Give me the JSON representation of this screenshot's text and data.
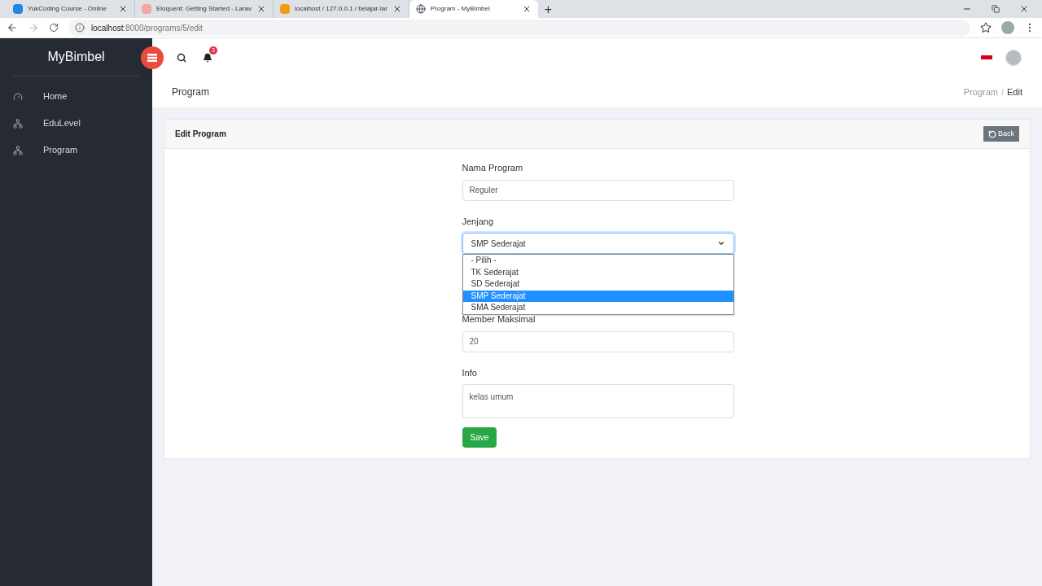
{
  "browser": {
    "tabs": [
      {
        "title": "YukCoding Course - Online",
        "selected": false
      },
      {
        "title": "Eloquent: Getting Started - Larav",
        "selected": false
      },
      {
        "title": "localhost / 127.0.0.1 / belajar-lar",
        "selected": false
      },
      {
        "title": "Program - MyBimbel",
        "selected": true
      }
    ],
    "new_tab": "+",
    "url_host": "localhost",
    "url_rest": ":8000/programs/5/edit"
  },
  "sidebar": {
    "brand": "MyBimbel",
    "items": [
      {
        "label": "Home",
        "kind": "dashboard"
      },
      {
        "label": "EduLevel",
        "kind": "sitemap"
      },
      {
        "label": "Program",
        "kind": "sitemap"
      }
    ]
  },
  "topbar": {
    "notification_count": "3"
  },
  "page_header": {
    "title": "Program",
    "breadcrumb_separator": "/",
    "breadcrumb": [
      {
        "label": "Program",
        "selected": false
      },
      {
        "label": "Edit",
        "selected": true
      }
    ]
  },
  "card": {
    "title": "Edit Program",
    "back_button": "Back"
  },
  "form": {
    "nama_program": {
      "label": "Nama Program",
      "value": "Reguler"
    },
    "jenjang": {
      "label": "Jenjang",
      "value": "SMP Sederajat",
      "expanded": true,
      "options": [
        {
          "label": "- Pilih -",
          "selected": false
        },
        {
          "label": "TK Sederajat",
          "selected": false
        },
        {
          "label": "SD Sederajat",
          "selected": false
        },
        {
          "label": "SMP Sederajat",
          "selected": true
        },
        {
          "label": "SMA Sederajat",
          "selected": false
        }
      ]
    },
    "member_maksimal": {
      "label": "Member Maksimal",
      "value": "20"
    },
    "info": {
      "label": "Info",
      "value": "kelas umum"
    },
    "save_button": "Save"
  }
}
